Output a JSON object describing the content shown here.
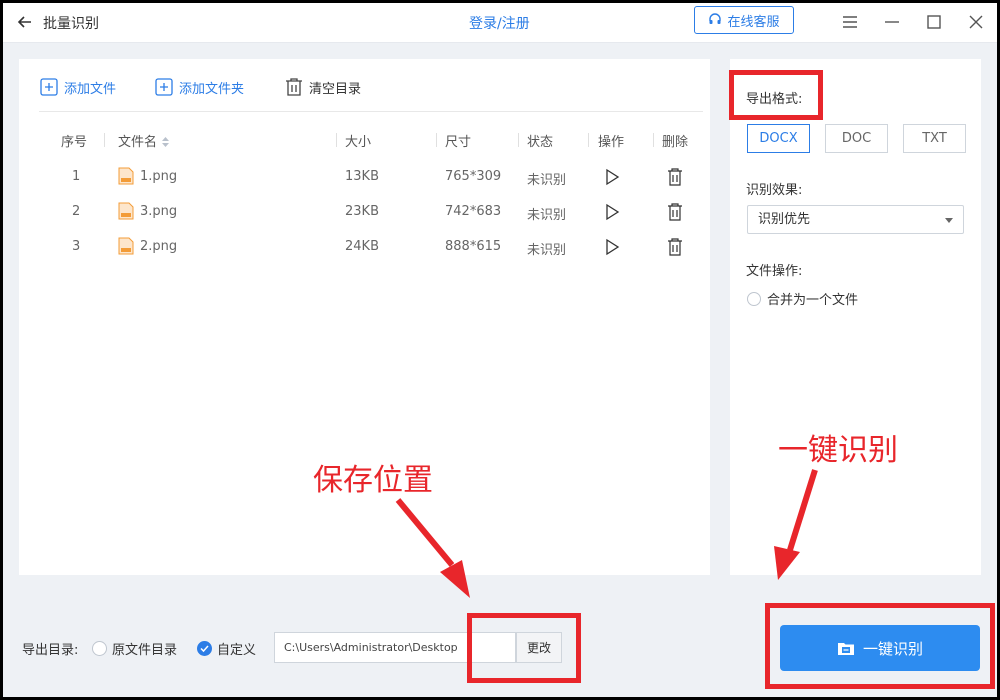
{
  "app": {
    "title": "批量识别",
    "login_label": "登录/注册",
    "service_label": "在线客服"
  },
  "toolbar": {
    "add_file": "添加文件",
    "add_folder": "添加文件夹",
    "clear_list": "清空目录"
  },
  "table": {
    "headers": [
      "序号",
      "文件名",
      "大小",
      "尺寸",
      "状态",
      "操作",
      "删除"
    ],
    "rows": [
      {
        "index": "1",
        "name": "1.png",
        "size": "13KB",
        "dimensions": "765*309",
        "status": "未识别"
      },
      {
        "index": "2",
        "name": "3.png",
        "size": "23KB",
        "dimensions": "742*683",
        "status": "未识别"
      },
      {
        "index": "3",
        "name": "2.png",
        "size": "24KB",
        "dimensions": "888*615",
        "status": "未识别"
      }
    ]
  },
  "settings": {
    "export_format_label": "导出格式:",
    "formats": [
      "DOCX",
      "DOC",
      "TXT"
    ],
    "selected_format": "DOCX",
    "effect_label": "识别效果:",
    "effect_value": "识别优先",
    "file_op_label": "文件操作:",
    "merge_label": "合并为一个文件"
  },
  "bottom": {
    "export_dir_label": "导出目录:",
    "option_original": "原文件目录",
    "option_custom": "自定义",
    "path_value": "C:\\Users\\Administrator\\Desktop",
    "change_label": "更改",
    "start_label": "一键识别"
  },
  "annotations": {
    "save_location": "保存位置",
    "one_click": "一键识别"
  },
  "colors": {
    "accent": "#2c7de6",
    "button": "#2d8cf0",
    "annotation": "#e8262b",
    "file_icon": "#f39c38"
  }
}
